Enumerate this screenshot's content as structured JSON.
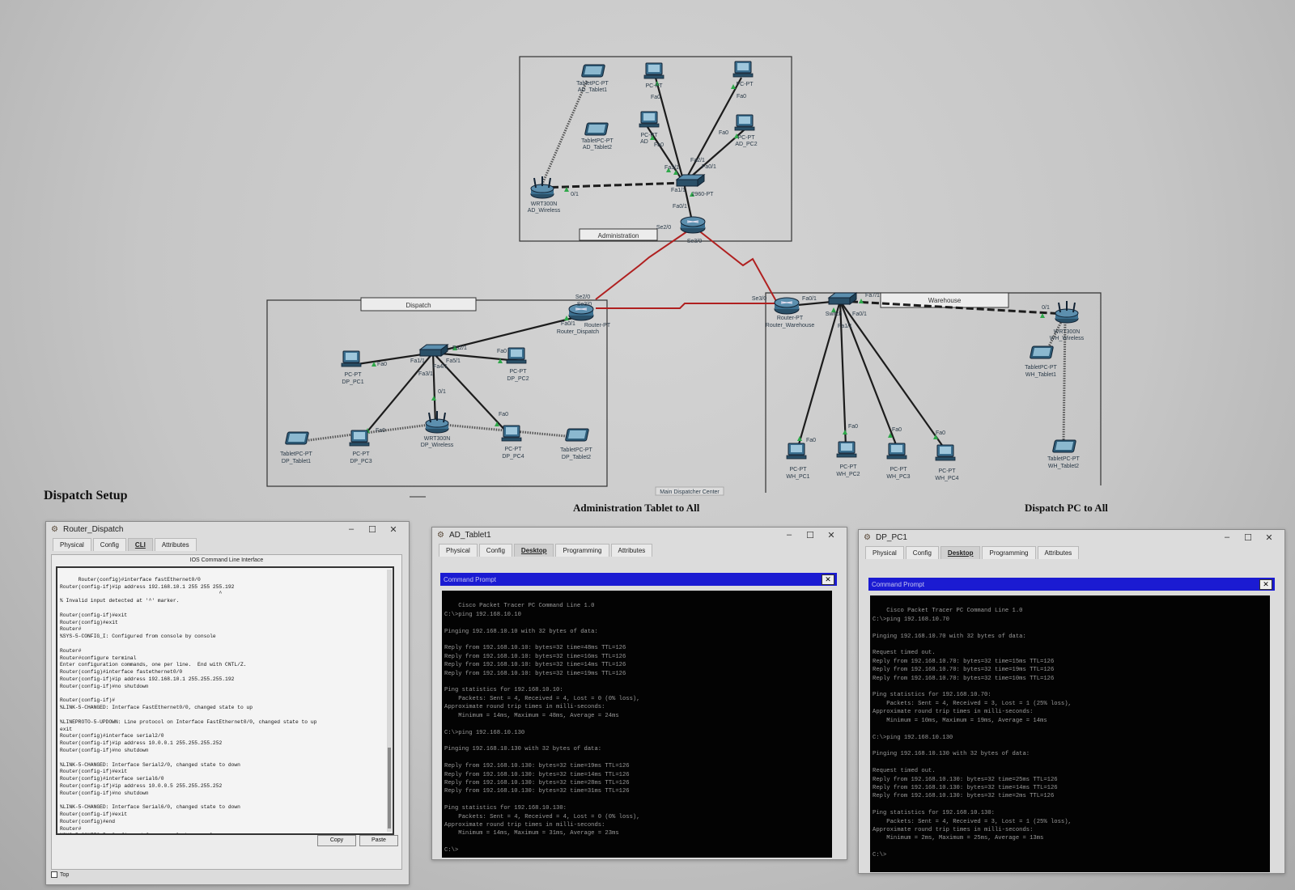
{
  "topology": {
    "areas": {
      "administration": "Administration",
      "dispatch": "Dispatch",
      "warehouse": "Warehouse",
      "bottom_tab": "Main Dispatcher Center"
    },
    "devices": {
      "ad_tablet1": [
        "TabletPC-PT",
        "AD_Tablet1"
      ],
      "ad_tablet2": [
        "TabletPC-PT",
        "AD_Tablet2"
      ],
      "ad_pc_top1": [
        "PC-PT",
        ""
      ],
      "ad_pc_top2": [
        "PC-PT",
        ""
      ],
      "ad_pc_mid": [
        "PC-PT",
        "AD"
      ],
      "ad_pc2": [
        "PC-PT",
        "AD_PC2"
      ],
      "ad_wireless": [
        "WRT300N",
        "AD_Wireless"
      ],
      "ad_switch": [
        "2960-PT",
        ""
      ],
      "ad_router": [
        "Router-PT",
        ""
      ],
      "dp_router": [
        "Router-PT",
        "Router_Dispatch"
      ],
      "dp_switch": [
        "2960",
        ""
      ],
      "dp_pc1": [
        "PC-PT",
        "DP_PC1"
      ],
      "dp_pc2": [
        "PC-PT",
        "DP_PC2"
      ],
      "dp_pc3": [
        "PC-PT",
        "DP_PC3"
      ],
      "dp_pc4": [
        "PC-PT",
        "DP_PC4"
      ],
      "dp_tablet1": [
        "TabletPC-PT",
        "DP_Tablet1"
      ],
      "dp_tablet2": [
        "TabletPC-PT",
        "DP_Tablet2"
      ],
      "dp_wireless": [
        "WRT300N",
        "DP_Wireless"
      ],
      "wh_router": [
        "Router-PT",
        "Router_Warehouse"
      ],
      "wh_switch": [
        "Switch",
        ""
      ],
      "wh_wireless": [
        "WRT300N",
        "WH_Wireless"
      ],
      "wh_tablet1": [
        "TabletPC-PT",
        "WH_Tablet1"
      ],
      "wh_tablet2": [
        "TabletPC-PT",
        "WH_Tablet2"
      ],
      "wh_pc1": [
        "PC-PT",
        "WH_PC1"
      ],
      "wh_pc2": [
        "PC-PT",
        "WH_PC2"
      ],
      "wh_pc3": [
        "PC-PT",
        "WH_PC3"
      ],
      "wh_pc4": [
        "PC-PT",
        "WH_PC4"
      ]
    },
    "ports": {
      "fa0": "Fa0",
      "fa01": "Fa0/1",
      "fa11": "Fa1/1",
      "fa21": "Fa2/1",
      "fa31": "Fa3/1",
      "fa41": "Fa4/1",
      "fa51": "Fa5/1",
      "fa71": "Fa7/1",
      "se20": "Se2/0",
      "se30": "Se3/0",
      "gi1": "0/1"
    },
    "colors": {
      "serial_link": "#b02020",
      "copper_link": "#1c1c1c",
      "wireless_link": "#555555",
      "port_up": "#2fa84a",
      "device": "#2c5a7a"
    }
  },
  "headings": {
    "dispatch_setup": "Dispatch Setup",
    "admin_tablet": "Administration Tablet to All",
    "dispatch_pc": "Dispatch PC to All"
  },
  "router_window": {
    "title": "Router_Dispatch",
    "tabs": [
      "Physical",
      "Config",
      "CLI",
      "Attributes"
    ],
    "cli_caption": "IOS Command Line Interface",
    "cli_text": "Router(config)#interface fastEthernet0/0\nRouter(config-if)#ip address 192.168.10.1 255 255 255.192\n                                                    ^\n% Invalid input detected at '^' marker.\n\nRouter(config-if)#exit\nRouter(config)#exit\nRouter#\n%SYS-5-CONFIG_I: Configured from console by console\n\nRouter#\nRouter#configure terminal\nEnter configuration commands, one per line.  End with CNTL/Z.\nRouter(config)#interface fastethernet0/0\nRouter(config-if)#ip address 192.168.10.1 255.255.255.192\nRouter(config-if)#no shutdown\n\nRouter(config-if)#\n%LINK-5-CHANGED: Interface FastEthernet0/0, changed state to up\n\n%LINEPROTO-5-UPDOWN: Line protocol on Interface FastEthernet0/0, changed state to up\nexit\nRouter(config)#interface serial2/0\nRouter(config-if)#ip address 10.0.0.1 255.255.255.252\nRouter(config-if)#no shutdown\n\n%LINK-5-CHANGED: Interface Serial2/0, changed state to down\nRouter(config-if)#exit\nRouter(config)#interface serial6/0\nRouter(config-if)#ip address 10.0.0.5 255.255.255.252\nRouter(config-if)#no shutdown\n\n%LINK-5-CHANGED: Interface Serial6/0, changed state to down\nRouter(config-if)#exit\nRouter(config)#end\nRouter#\n%SYS-5-CONFIG_I: Configured from console by console",
    "copy_label": "Copy",
    "paste_label": "Paste",
    "top_label": "Top"
  },
  "ad_window": {
    "title": "AD_Tablet1",
    "tabs": [
      "Physical",
      "Config",
      "Desktop",
      "Programming",
      "Attributes"
    ],
    "cmd_title": "Command Prompt",
    "terminal": "Cisco Packet Tracer PC Command Line 1.0\nC:\\>ping 192.168.10.10\n\nPinging 192.168.10.10 with 32 bytes of data:\n\nReply from 192.168.10.10: bytes=32 time=48ms TTL=126\nReply from 192.168.10.10: bytes=32 time=16ms TTL=126\nReply from 192.168.10.10: bytes=32 time=14ms TTL=126\nReply from 192.168.10.10: bytes=32 time=19ms TTL=126\n\nPing statistics for 192.168.10.10:\n    Packets: Sent = 4, Received = 4, Lost = 0 (0% loss),\nApproximate round trip times in milli-seconds:\n    Minimum = 14ms, Maximum = 48ms, Average = 24ms\n\nC:\\>ping 192.168.10.130\n\nPinging 192.168.10.130 with 32 bytes of data:\n\nReply from 192.168.10.130: bytes=32 time=19ms TTL=126\nReply from 192.168.10.130: bytes=32 time=14ms TTL=126\nReply from 192.168.10.130: bytes=32 time=28ms TTL=126\nReply from 192.168.10.130: bytes=32 time=31ms TTL=126\n\nPing statistics for 192.168.10.130:\n    Packets: Sent = 4, Received = 4, Lost = 0 (0% loss),\nApproximate round trip times in milli-seconds:\n    Minimum = 14ms, Maximum = 31ms, Average = 23ms\n\nC:\\>"
  },
  "dp_window": {
    "title": "DP_PC1",
    "tabs": [
      "Physical",
      "Config",
      "Desktop",
      "Programming",
      "Attributes"
    ],
    "cmd_title": "Command Prompt",
    "terminal": "Cisco Packet Tracer PC Command Line 1.0\nC:\\>ping 192.168.10.70\n\nPinging 192.168.10.70 with 32 bytes of data:\n\nRequest timed out.\nReply from 192.168.10.70: bytes=32 time=15ms TTL=126\nReply from 192.168.10.70: bytes=32 time=19ms TTL=126\nReply from 192.168.10.70: bytes=32 time=10ms TTL=126\n\nPing statistics for 192.168.10.70:\n    Packets: Sent = 4, Received = 3, Lost = 1 (25% loss),\nApproximate round trip times in milli-seconds:\n    Minimum = 10ms, Maximum = 19ms, Average = 14ms\n\nC:\\>ping 192.168.10.130\n\nPinging 192.168.10.130 with 32 bytes of data:\n\nRequest timed out.\nReply from 192.168.10.130: bytes=32 time=25ms TTL=126\nReply from 192.168.10.130: bytes=32 time=14ms TTL=126\nReply from 192.168.10.130: bytes=32 time=2ms TTL=126\n\nPing statistics for 192.168.10.130:\n    Packets: Sent = 4, Received = 3, Lost = 1 (25% loss),\nApproximate round trip times in milli-seconds:\n    Minimum = 2ms, Maximum = 25ms, Average = 13ms\n\nC:\\>"
  }
}
